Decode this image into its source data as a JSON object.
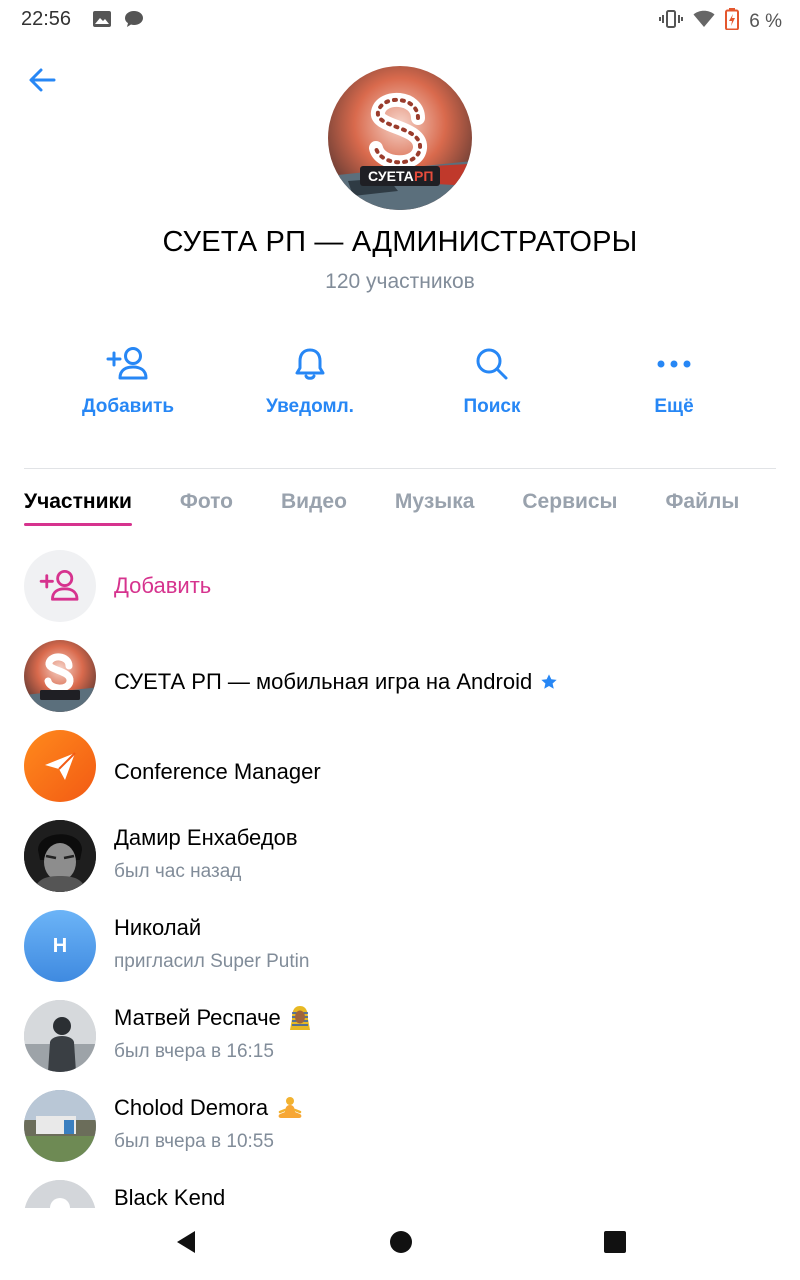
{
  "status_bar": {
    "time": "22:56",
    "battery": "6 %"
  },
  "header": {
    "title": "СУЕТА РП — АДМИНИСТРАТОРЫ",
    "subtitle": "120 участников",
    "avatar_text_1": "СУЕТА",
    "avatar_text_2": "РП"
  },
  "actions": [
    {
      "label": "Добавить",
      "icon": "add-user-icon"
    },
    {
      "label": "Уведомл.",
      "icon": "bell-icon"
    },
    {
      "label": "Поиск",
      "icon": "search-icon"
    },
    {
      "label": "Ещё",
      "icon": "more-icon"
    }
  ],
  "tabs": [
    "Участники",
    "Фото",
    "Видео",
    "Музыка",
    "Сервисы",
    "Файлы"
  ],
  "add_member_label": "Добавить",
  "members": [
    {
      "name": "СУЕТА РП — мобильная игра на Android",
      "status": ""
    },
    {
      "name": "Conference Manager",
      "status": ""
    },
    {
      "name": "Дамир Енхабедов",
      "status": "был час назад"
    },
    {
      "name": "Николай",
      "status": "пригласил Super Putin",
      "initial": "Н"
    },
    {
      "name": "Матвей Респаче",
      "status": "был вчера в 16:15"
    },
    {
      "name": "Cholod Demora",
      "status": "был вчера в 10:55"
    },
    {
      "name": "Black Kend",
      "status": ""
    }
  ],
  "colors": {
    "accent_blue": "#2787f5",
    "accent_pink": "#d6338e",
    "secondary_text": "#818c99"
  }
}
